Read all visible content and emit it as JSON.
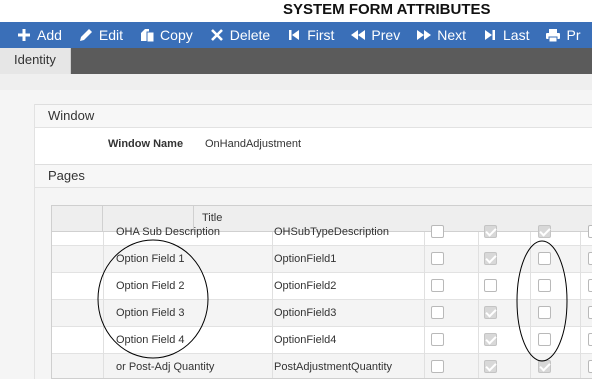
{
  "page": {
    "title": "SYSTEM FORM ATTRIBUTES"
  },
  "toolbar": {
    "buttons": [
      {
        "label": "Add",
        "icon": "plus-icon"
      },
      {
        "label": "Edit",
        "icon": "pencil-icon"
      },
      {
        "label": "Copy",
        "icon": "copy-icon"
      },
      {
        "label": "Delete",
        "icon": "close-icon"
      },
      {
        "label": "First",
        "icon": "first-icon"
      },
      {
        "label": "Prev",
        "icon": "rewind-icon"
      },
      {
        "label": "Next",
        "icon": "fast-forward-icon"
      },
      {
        "label": "Last",
        "icon": "last-icon"
      },
      {
        "label": "Pr",
        "icon": "print-icon"
      }
    ],
    "color": "#3a6fb8"
  },
  "tabs": [
    {
      "label": "Identity",
      "active": true
    }
  ],
  "window_section": {
    "heading": "Window",
    "window_name_label": "Window Name",
    "window_name_value": "OnHandAdjustment"
  },
  "pages_section": {
    "heading": "Pages",
    "grid": {
      "columns": [
        "Title"
      ],
      "rows": [
        {
          "title": "OHA Sub Description",
          "field": "OHSubTypeDescription",
          "checks": [
            false,
            true,
            true,
            false
          ]
        },
        {
          "title": "Option Field 1",
          "field": "OptionField1",
          "checks": [
            false,
            true,
            false,
            false
          ]
        },
        {
          "title": "Option Field 2",
          "field": "OptionField2",
          "checks": [
            false,
            false,
            false,
            false
          ]
        },
        {
          "title": "Option Field 3",
          "field": "OptionField3",
          "checks": [
            false,
            true,
            false,
            false
          ]
        },
        {
          "title": "Option Field 4",
          "field": "OptionField4",
          "checks": [
            false,
            true,
            false,
            false
          ]
        },
        {
          "title": "or Post-Adj Quantity",
          "field": "PostAdjustmentQuantity",
          "checks": [
            false,
            true,
            true,
            false
          ]
        }
      ]
    }
  }
}
